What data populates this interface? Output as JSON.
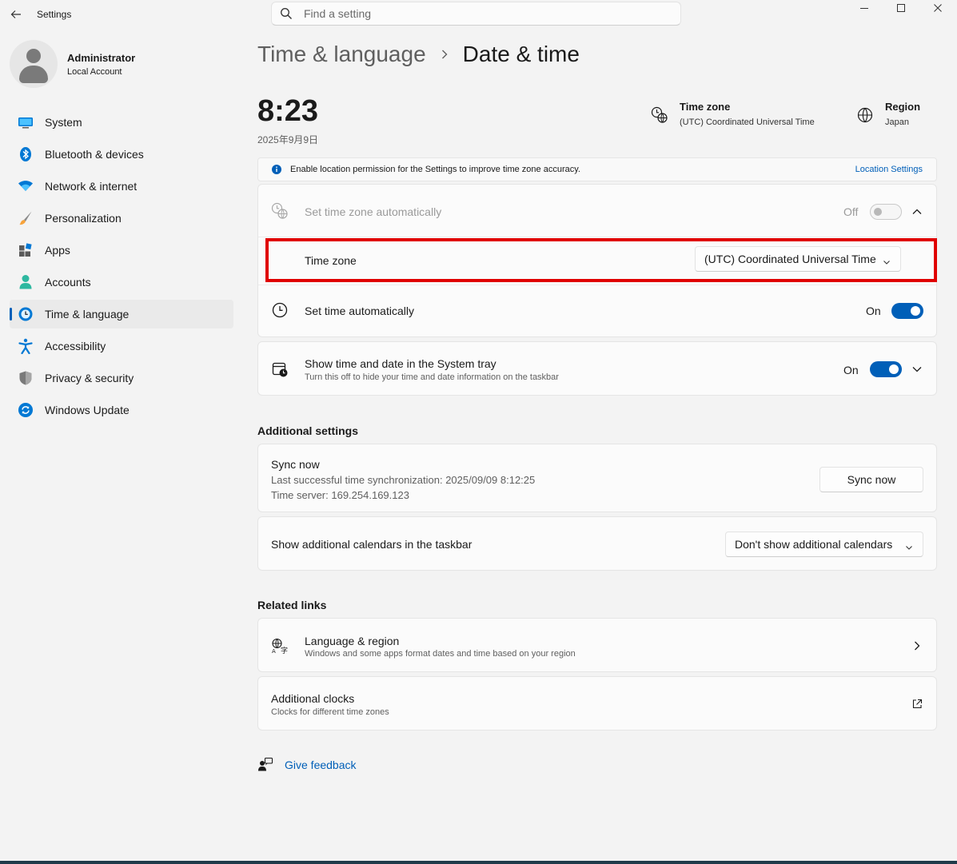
{
  "app": {
    "title": "Settings"
  },
  "search": {
    "placeholder": "Find a setting"
  },
  "profile": {
    "name": "Administrator",
    "account_type": "Local Account"
  },
  "nav": {
    "items": [
      {
        "label": "System",
        "icon": "system-icon"
      },
      {
        "label": "Bluetooth & devices",
        "icon": "bluetooth-icon"
      },
      {
        "label": "Network & internet",
        "icon": "wifi-icon"
      },
      {
        "label": "Personalization",
        "icon": "brush-icon"
      },
      {
        "label": "Apps",
        "icon": "apps-icon"
      },
      {
        "label": "Accounts",
        "icon": "accounts-icon"
      },
      {
        "label": "Time & language",
        "icon": "time-language-icon",
        "active": true
      },
      {
        "label": "Accessibility",
        "icon": "accessibility-icon"
      },
      {
        "label": "Privacy & security",
        "icon": "shield-icon"
      },
      {
        "label": "Windows Update",
        "icon": "update-icon"
      }
    ]
  },
  "breadcrumb": {
    "parent": "Time & language",
    "current": "Date & time"
  },
  "clock": {
    "time": "8:23",
    "date": "2025年9月9日"
  },
  "header_info": {
    "timezone": {
      "title": "Time zone",
      "value": "(UTC) Coordinated Universal Time"
    },
    "region": {
      "title": "Region",
      "value": "Japan"
    }
  },
  "banner": {
    "text": "Enable location permission for the Settings to improve time zone accuracy.",
    "link": "Location Settings"
  },
  "settings": {
    "auto_timezone": {
      "label": "Set time zone automatically",
      "state": "Off"
    },
    "timezone": {
      "label": "Time zone",
      "value": "(UTC) Coordinated Universal Time"
    },
    "auto_time": {
      "label": "Set time automatically",
      "state": "On"
    },
    "system_tray": {
      "label": "Show time and date in the System tray",
      "description": "Turn this off to hide your time and date information on the taskbar",
      "state": "On"
    }
  },
  "additional": {
    "title": "Additional settings",
    "sync": {
      "label": "Sync now",
      "last_sync": "Last successful time synchronization: 2025/09/09 8:12:25",
      "server": "Time server: 169.254.169.123",
      "button": "Sync now"
    },
    "calendars": {
      "label": "Show additional calendars in the taskbar",
      "value": "Don't show additional calendars"
    }
  },
  "related": {
    "title": "Related links",
    "language_region": {
      "label": "Language & region",
      "description": "Windows and some apps format dates and time based on your region"
    },
    "clocks": {
      "label": "Additional clocks",
      "description": "Clocks for different time zones"
    }
  },
  "feedback": {
    "label": "Give feedback"
  },
  "colors": {
    "accent": "#005fb8",
    "highlight": "#e00000",
    "background": "#f3f3f3"
  }
}
